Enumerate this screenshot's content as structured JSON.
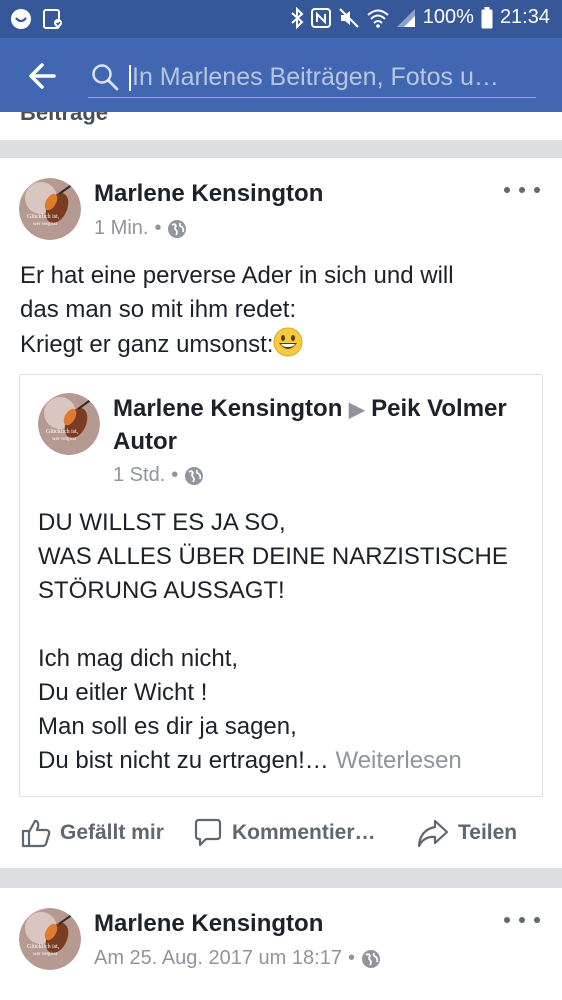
{
  "status_bar": {
    "icons": [
      "messenger-icon",
      "image-icon",
      "bluetooth-icon",
      "nfc-icon",
      "mute-icon",
      "wifi-icon",
      "signal-icon",
      "battery-icon"
    ],
    "battery": "100%",
    "time": "21:34"
  },
  "search": {
    "placeholder": "In Marlenes Beiträgen, Fotos u…"
  },
  "section_label": "Beiträge",
  "posts": [
    {
      "author": "Marlene Kensington",
      "time": "1 Min.",
      "text_lines": [
        "Er hat eine perverse Ader in sich und will",
        "das man so mit ihm redet:",
        "Kriegt er ganz umsonst:"
      ],
      "shared": {
        "author": "Marlene Kensington",
        "target": "Peik Volmer Autor",
        "time": "1 Std.",
        "lines": [
          "DU WILLST ES JA SO,",
          "WAS ALLES ÜBER DEINE NARZISTISCHE",
          "STÖRUNG AUSSAGT!",
          "",
          "Ich mag dich nicht,",
          "Du eitler Wicht !",
          "Man soll es dir ja sagen,",
          "Du bist nicht zu ertragen!…"
        ],
        "read_more": "Weiterlesen"
      },
      "actions": {
        "like": "Gefällt mir",
        "comment": "Kommentier…",
        "share": "Teilen"
      }
    },
    {
      "author": "Marlene Kensington",
      "time": "Am 25. Aug. 2017 um 18:17"
    }
  ],
  "colors": {
    "status_bar": "#365899",
    "app_bar": "#4267b2",
    "muted_text": "#90949c",
    "divider": "#dddfe2"
  }
}
